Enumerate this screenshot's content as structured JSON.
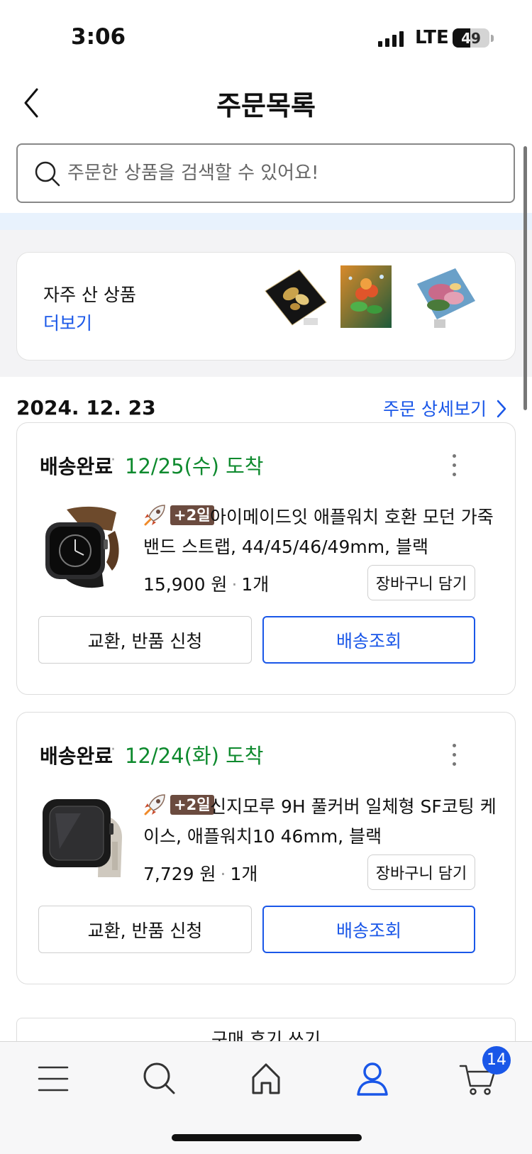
{
  "status_bar": {
    "time": "3:06",
    "network": "LTE",
    "battery": "49",
    "battery_level": 0.49
  },
  "header": {
    "title": "주문목록",
    "back_icon": "chevron-left-icon"
  },
  "search": {
    "placeholder": "주문한 상품을 검색할 수 있어요!",
    "value": ""
  },
  "frequent": {
    "label": "자주 산 상품",
    "more": "더보기"
  },
  "order_group": {
    "date": "2024. 12. 23",
    "detail_link": "주문 상세보기"
  },
  "orders": [
    {
      "status": "배송완료",
      "arrival": "12/25(수) 도착",
      "badge": "+2일",
      "name": "아이메이드잇 애플워치 호환 모던 가죽 밴드 스트랩, 44/45/46/49mm, 블랙",
      "price": "15,900 원",
      "qty": "1개",
      "cart_label": "장바구니 담기",
      "exchange_label": "교환, 반품 신청",
      "track_label": "배송조회"
    },
    {
      "status": "배송완료",
      "arrival": "12/24(화) 도착",
      "badge": "+2일",
      "name": "신지모루 9H 풀커버 일체형 SF코팅 케이스, 애플워치10 46mm, 블랙",
      "price": "7,729 원",
      "qty": "1개",
      "cart_label": "장바구니 담기",
      "exchange_label": "교환, 반품 신청",
      "track_label": "배송조회"
    }
  ],
  "review_button": "구매 후기 쓰기",
  "tabbar": {
    "cart_count": "14"
  },
  "colors": {
    "accent": "#1a57e8",
    "arrival_green": "#0e8a2e",
    "badge_brown": "#6b4b3f"
  }
}
